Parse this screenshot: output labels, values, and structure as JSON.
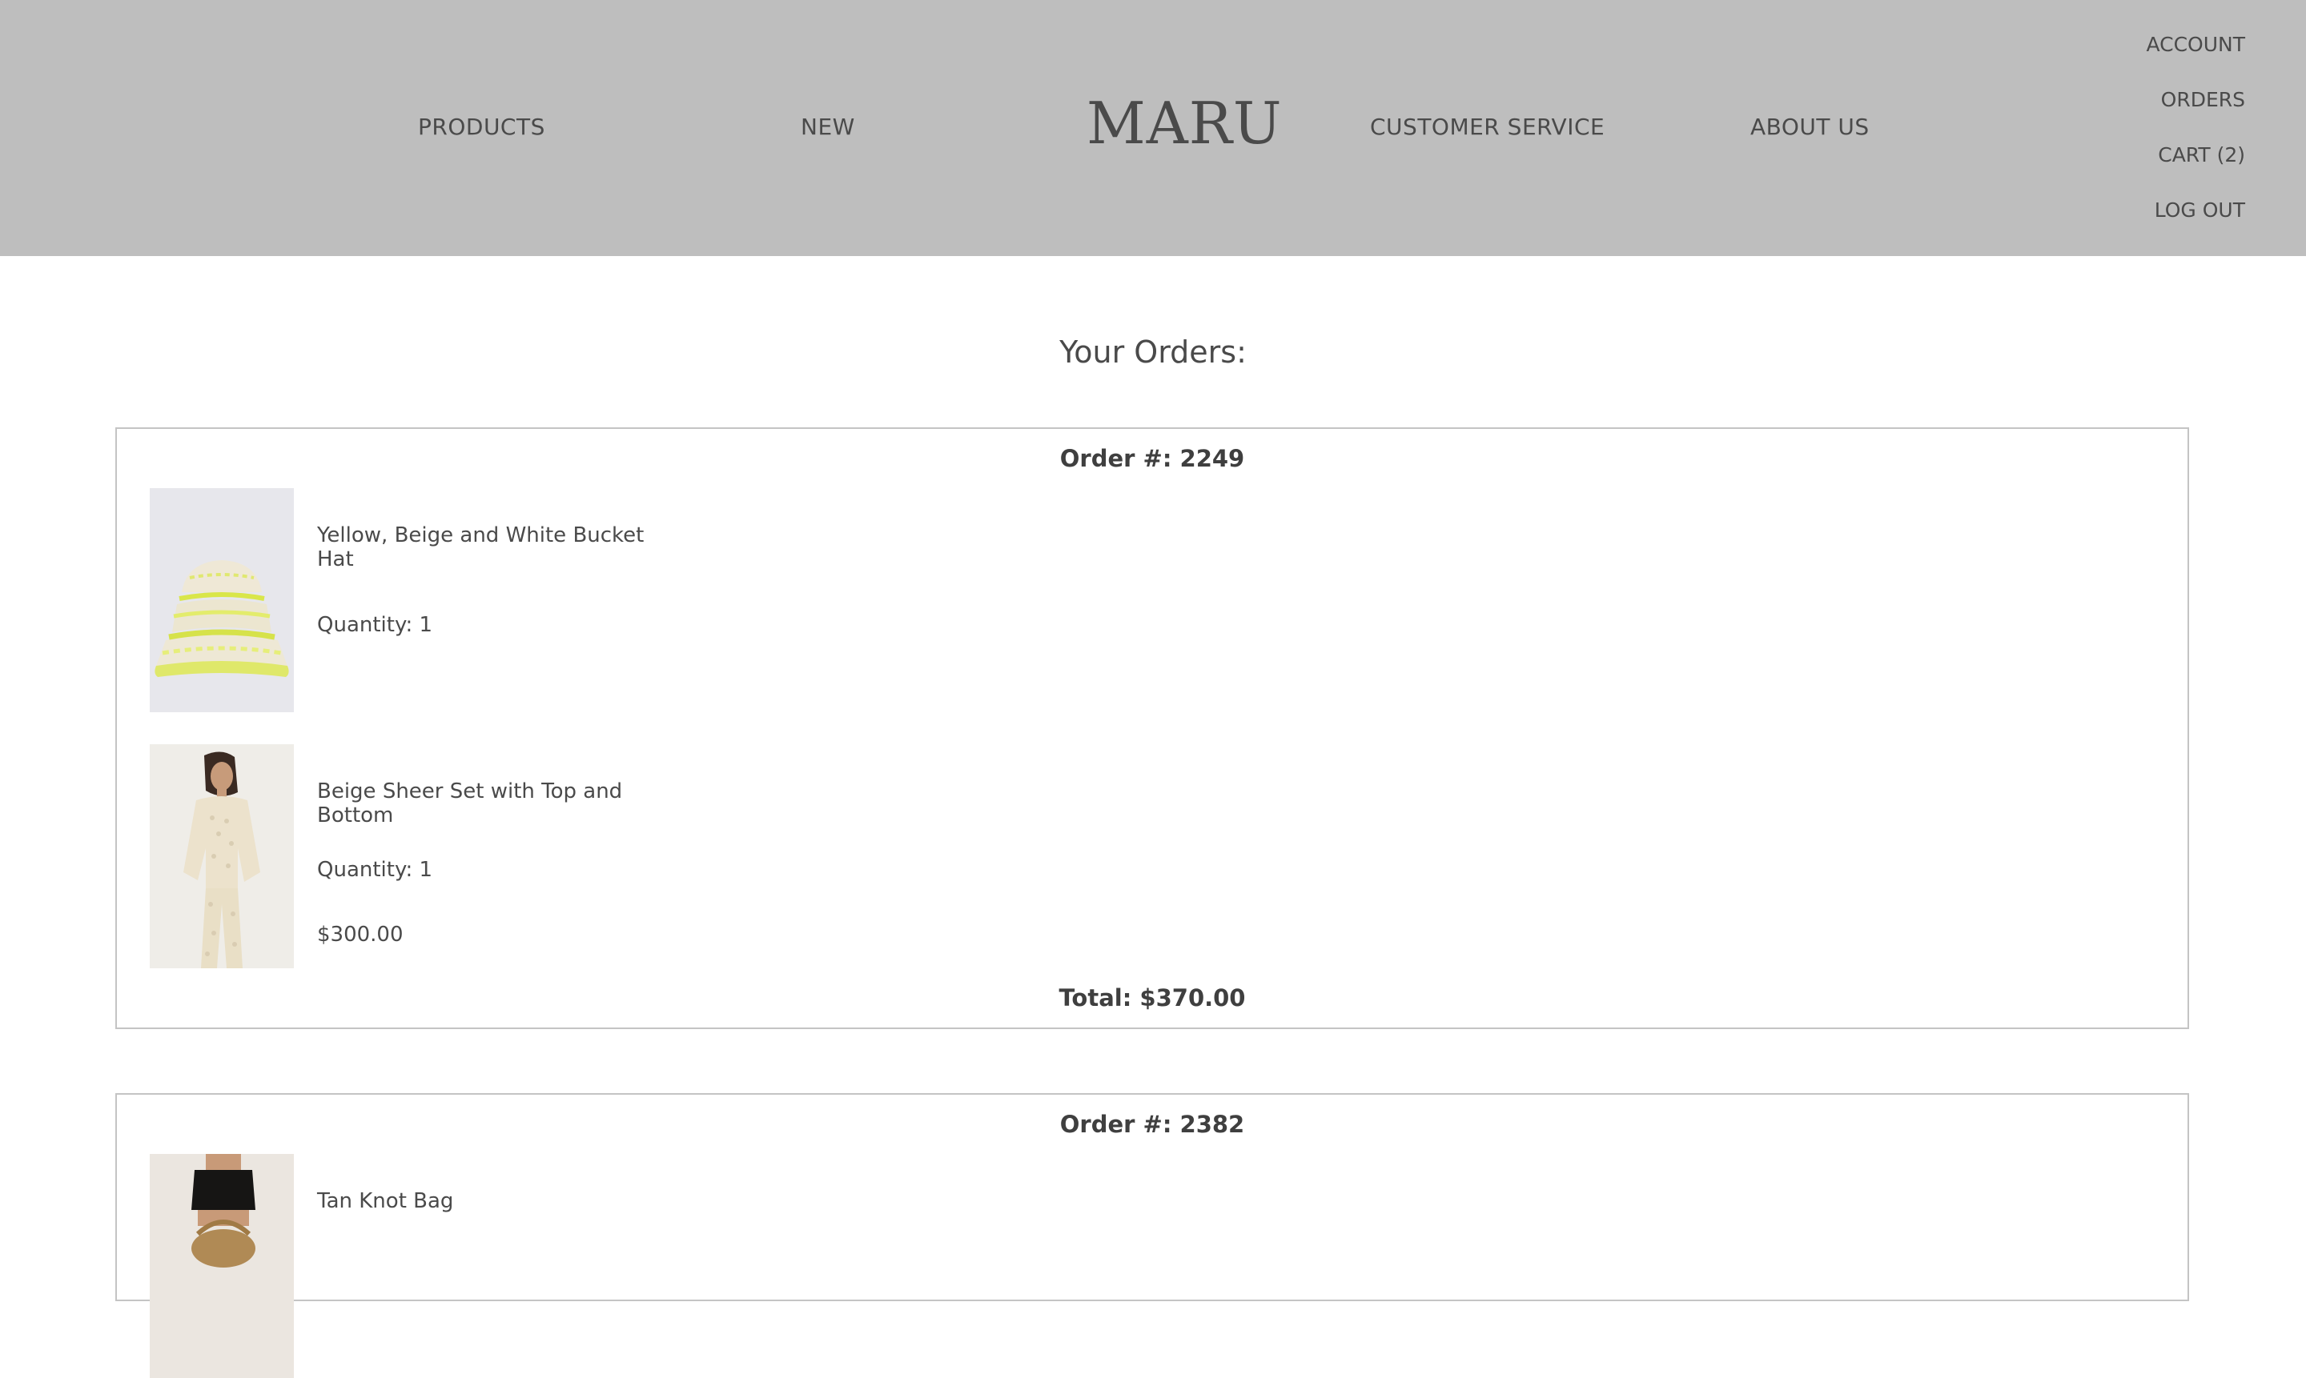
{
  "header": {
    "brand": "MARU",
    "nav": {
      "products": "PRODUCTS",
      "new": "NEW",
      "customer_service": "CUSTOMER SERVICE",
      "about_us": "ABOUT US"
    },
    "account_menu": {
      "account": "ACCOUNT",
      "orders": "ORDERS",
      "cart": "CART (2)",
      "logout": "LOG OUT"
    }
  },
  "page_title": "Your Orders:",
  "orders": [
    {
      "number": "Order #: 2249",
      "items": [
        {
          "name": "Yellow, Beige and White Bucket Hat",
          "quantity": "Quantity: 1",
          "image": "bucket-hat-image"
        },
        {
          "name": "Beige Sheer Set with Top and Bottom",
          "quantity": "Quantity: 1",
          "price": "$300.00",
          "image": "sheer-set-image"
        }
      ],
      "total": "Total: $370.00"
    },
    {
      "number": "Order #: 2382",
      "items": [
        {
          "name": "Tan Knot Bag",
          "image": "knot-bag-image"
        }
      ]
    }
  ],
  "colors": {
    "header_bg": "#bebebe",
    "text": "#4a4a4a",
    "card_border": "#c4c4c4"
  }
}
